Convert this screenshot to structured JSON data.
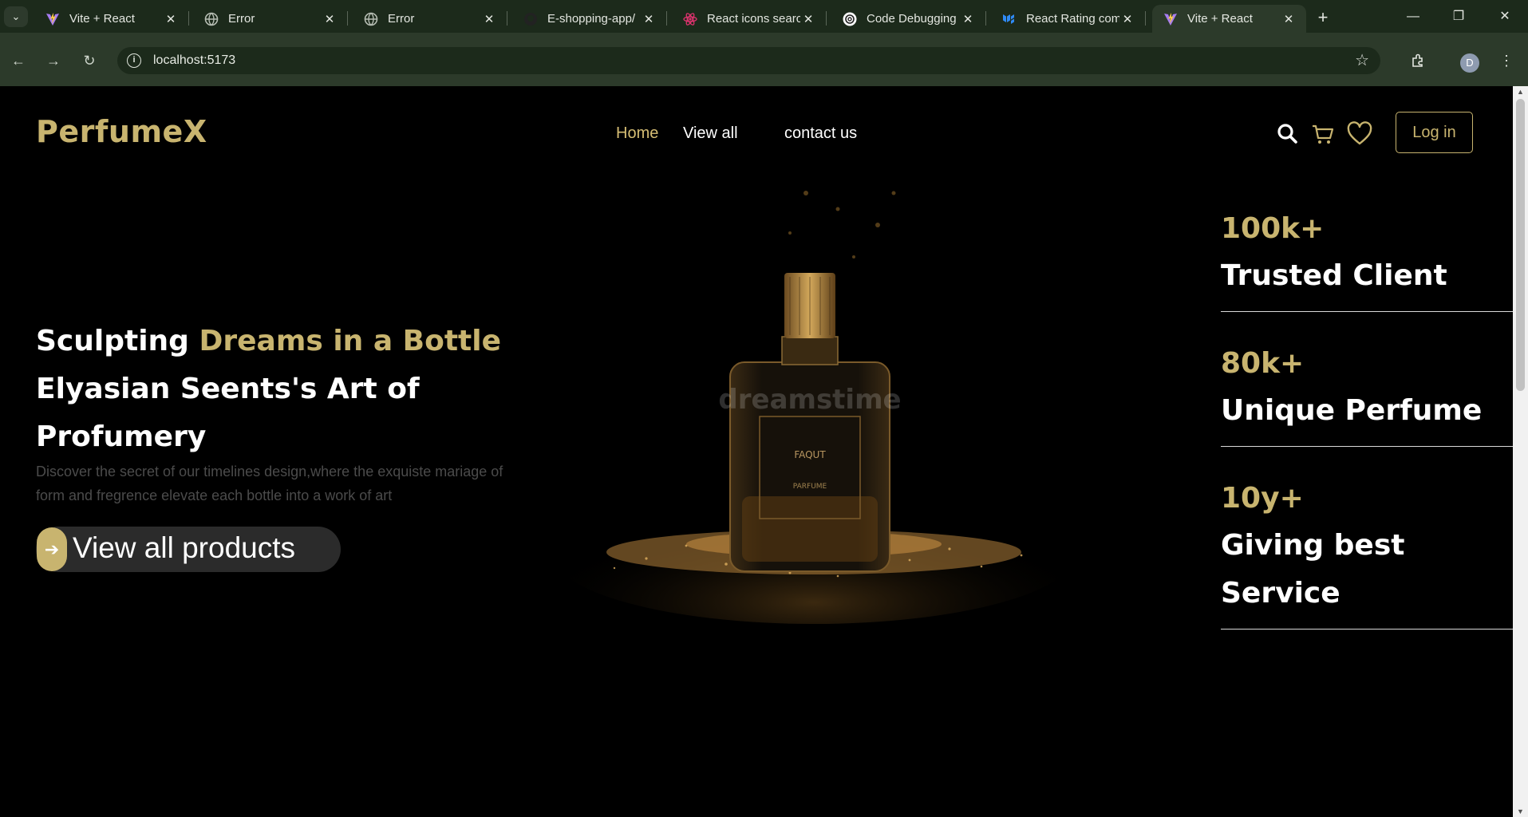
{
  "browser": {
    "tabs": [
      {
        "title": "Vite + React",
        "icon": "vite-icon"
      },
      {
        "title": "Error",
        "icon": "globe-icon"
      },
      {
        "title": "Error",
        "icon": "globe-icon"
      },
      {
        "title": "E-shopping-app/",
        "icon": "github-icon"
      },
      {
        "title": "React icons searc",
        "icon": "react-icon"
      },
      {
        "title": "Code Debugging",
        "icon": "openai-icon"
      },
      {
        "title": "React Rating com",
        "icon": "mui-icon"
      },
      {
        "title": "Vite + React",
        "icon": "vite-icon",
        "active": true
      }
    ],
    "url": "localhost:5173",
    "profile_initial": "D"
  },
  "site": {
    "logo": "PerfumeX",
    "nav": {
      "home": "Home",
      "view_all": "View all",
      "contact": "contact us"
    },
    "login": "Log in",
    "hero": {
      "title_part1": "Sculpting ",
      "title_gold": "Dreams in a Bottle",
      "title_part2": " Elyasian Seents's Art of Profumery",
      "subtitle": "Discover the secret of our timelines design,where the exquiste mariage of form and fregrence elevate each bottle into a work of art",
      "cta": "View all products"
    },
    "product_image": {
      "watermark": "dreamstime",
      "label_brand": "FAQUT",
      "label_type": "PARFUME"
    },
    "stats": [
      {
        "value": "100k+",
        "label": "Trusted Client"
      },
      {
        "value": "80k+",
        "label": "Unique Perfume"
      },
      {
        "value": "10y+",
        "label": "Giving best Service"
      }
    ]
  },
  "colors": {
    "accent_gold": "#c8b46f",
    "nav_active": "#d6be74",
    "page_bg": "#000000",
    "chrome_bg": "#2c3a2a"
  }
}
